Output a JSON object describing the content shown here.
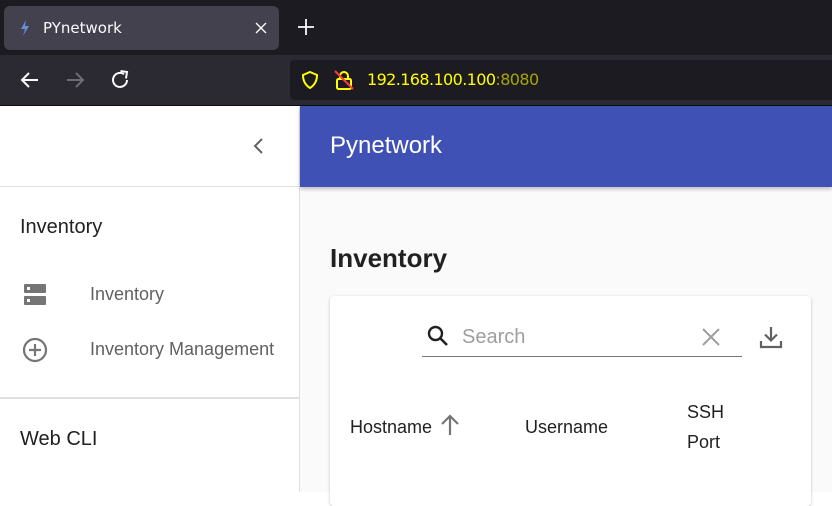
{
  "browser": {
    "tab_title": "PYnetwork",
    "url_host": "192.168.100.100",
    "url_port": ":8080"
  },
  "sidebar": {
    "sections": [
      {
        "title": "Inventory",
        "items": [
          {
            "label": "Inventory",
            "icon": "server-icon"
          },
          {
            "label": "Inventory Management",
            "icon": "add-circle-icon"
          }
        ]
      },
      {
        "title": "Web CLI",
        "items": []
      }
    ]
  },
  "appbar": {
    "title": "Pynetwork"
  },
  "page": {
    "title": "Inventory"
  },
  "table": {
    "search_placeholder": "Search",
    "columns": [
      {
        "label": "Hostname",
        "sorted": "ascending"
      },
      {
        "label": "Username"
      },
      {
        "label": "SSH Port"
      }
    ]
  },
  "colors": {
    "appbar": "#3f51b5",
    "url_text": "#ffff00"
  }
}
